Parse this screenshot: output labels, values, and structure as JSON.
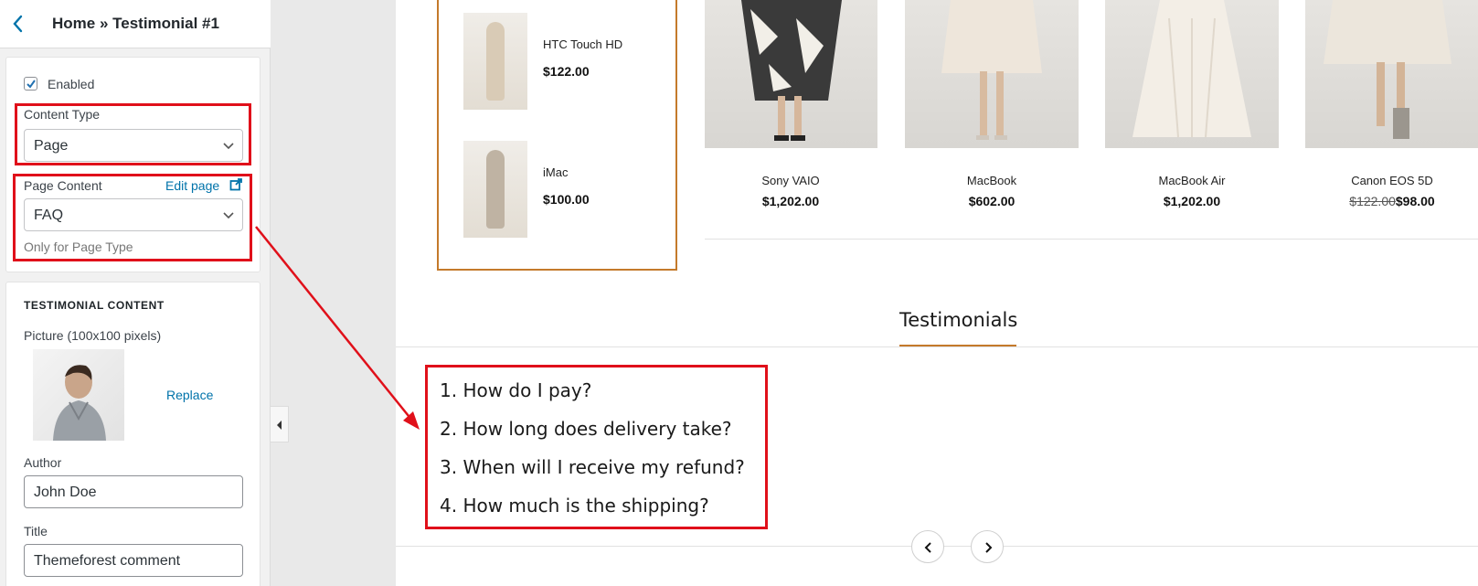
{
  "panel": {
    "breadcrumb": "Home » Testimonial #1",
    "enabled_label": "Enabled",
    "enabled_checked": true,
    "content_type": {
      "label": "Content Type",
      "value": "Page"
    },
    "page_content": {
      "label": "Page Content",
      "edit_link": "Edit page",
      "value": "FAQ",
      "helper": "Only for Page Type"
    },
    "testimonial": {
      "section_title": "TESTIMONIAL CONTENT",
      "picture_label": "Picture (100x100 pixels)",
      "replace_link": "Replace",
      "author_label": "Author",
      "author_value": "John Doe",
      "title_label": "Title",
      "title_value": "Themeforest comment"
    }
  },
  "preview": {
    "sidebar_products": [
      {
        "name": "HTC Touch HD",
        "price": "$122.00"
      },
      {
        "name": "iMac",
        "price": "$100.00"
      }
    ],
    "grid_products": [
      {
        "name": "Sony VAIO",
        "price": "$1,202.00"
      },
      {
        "name": "MacBook",
        "price": "$602.00"
      },
      {
        "name": "MacBook Air",
        "price": "$1,202.00"
      },
      {
        "name": "Canon EOS 5D",
        "old_price": "$122.00",
        "price": "$98.00"
      }
    ],
    "section_heading": "Testimonials",
    "faq": [
      "1. How do I pay?",
      "2. How long does delivery take?",
      "3. When will I receive my refund?",
      "4. How much is the shipping?"
    ]
  },
  "colors": {
    "highlight": "#e0101a",
    "accent": "#c47a2b",
    "link": "#0073aa"
  }
}
